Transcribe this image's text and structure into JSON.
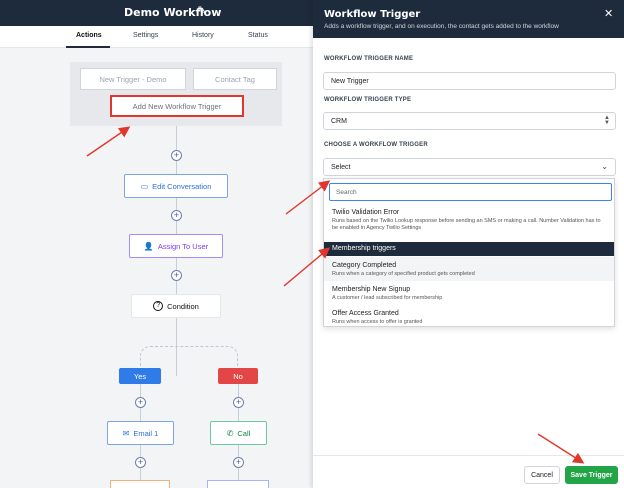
{
  "workflow": {
    "title": "Demo Workflow",
    "tabs": [
      "Actions",
      "Settings",
      "History",
      "Status"
    ]
  },
  "builder": {
    "triggers": [
      "New Trigger - Demo",
      "Contact Tag"
    ],
    "add_trigger_label": "Add New Workflow Trigger",
    "nodes": {
      "edit_conversation": "Edit Conversation",
      "assign_to_user": "Assign To User",
      "condition": "Condition",
      "yes": "Yes",
      "no": "No",
      "email": "Email 1",
      "call": "Call"
    }
  },
  "panel": {
    "title": "Workflow Trigger",
    "subtitle": "Adds a workflow trigger, and on execution, the contact gets added to the workflow",
    "name_label": "WORKFLOW TRIGGER NAME",
    "name_value": "New Trigger",
    "type_label": "WORKFLOW TRIGGER TYPE",
    "type_value": "CRM",
    "choose_label": "CHOOSE A WORKFLOW TRIGGER",
    "choose_value": "Select",
    "search_placeholder": "Search",
    "options": [
      {
        "title": "Twilio Validation Error",
        "desc": "Runs based on the Twilio Lookup response before sending an SMS or making a call. Number Validation has to be enabled in Agency Twilio Settings"
      },
      {
        "title": "Membership triggers",
        "desc": ""
      },
      {
        "title": "Category Completed",
        "desc": "Runs when a category of specified product gets completed"
      },
      {
        "title": "Membership New Signup",
        "desc": "A customer / lead subscribed for membership"
      },
      {
        "title": "Offer Access Granted",
        "desc": "Runs when access to offer is granted"
      }
    ],
    "cancel_label": "Cancel",
    "save_label": "Save Trigger"
  },
  "colors": {
    "header_bg": "#1e2b3c",
    "highlight_red": "#e0362c",
    "save_green": "#22a447",
    "yes_blue": "#2f7be8",
    "no_red": "#e34646"
  }
}
